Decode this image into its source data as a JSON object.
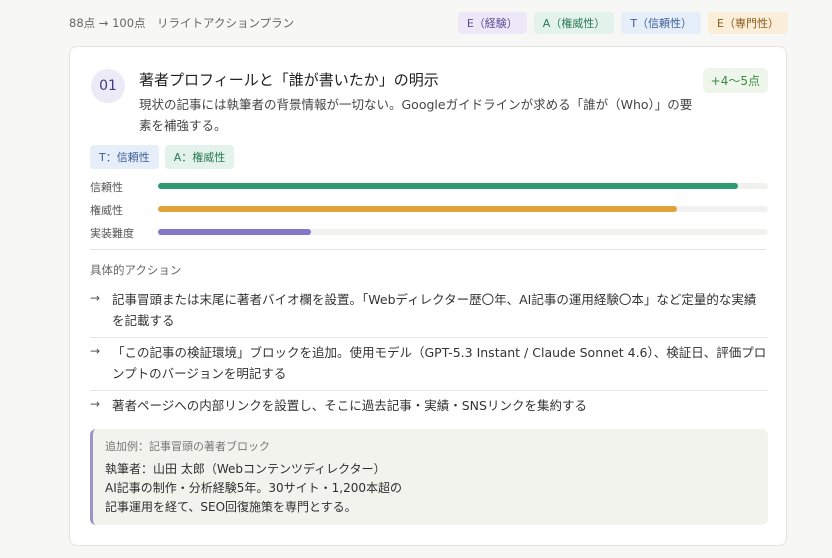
{
  "header": {
    "plan_title": "88点 → 100点　リライトアクションプラン",
    "legend": [
      {
        "label": "E（経験）"
      },
      {
        "label": "A（権威性）"
      },
      {
        "label": "T（信頼性）"
      },
      {
        "label": "E（専門性）"
      }
    ]
  },
  "card": {
    "number": "01",
    "title": "著者プロフィールと「誰が書いたか」の明示",
    "score": "+4〜5点",
    "description": "現状の記事には執筆者の背景情報が一切ない。Googleガイドラインが求める「誰が（Who）」の要素を補強する。",
    "tags": [
      {
        "label": "T：信頼性",
        "color": "#e6eef9",
        "text_color": "#3b5f96"
      },
      {
        "label": "A：権威性",
        "color": "#e3f2ea",
        "text_color": "#2a7a55"
      }
    ],
    "bars": [
      {
        "label": "信頼性",
        "value": 0.95,
        "color": "#2e9b72"
      },
      {
        "label": "権威性",
        "value": 0.85,
        "color": "#e0a33b"
      },
      {
        "label": "実装難度",
        "value": 0.25,
        "color": "#8478c9"
      }
    ],
    "actions_label": "具体的アクション",
    "actions": [
      {
        "text": "記事冒頭または末尾に著者バイオ欄を設置。「Webディレクター歴〇年、AI記事の運用経験〇本」など定量的な実績を記載する"
      },
      {
        "text": "「この記事の検証環境」ブロックを追加。使用モデル（GPT-5.3 Instant / Claude Sonnet 4.6）、検証日、評価プロンプトのバージョンを明記する"
      },
      {
        "text": "著者ページへの内部リンクを設置し、そこに過去記事・実績・SNSリンクを集約する"
      }
    ],
    "example": {
      "label": "追加例：記事冒頭の著者ブロック",
      "lines": [
        "執筆者：山田 太郎（Webコンテンツディレクター）",
        "AI記事の制作・分析経験5年。30サイト・1,200本超の",
        "記事運用を経て、SEO回復施策を専門とする。"
      ]
    }
  }
}
